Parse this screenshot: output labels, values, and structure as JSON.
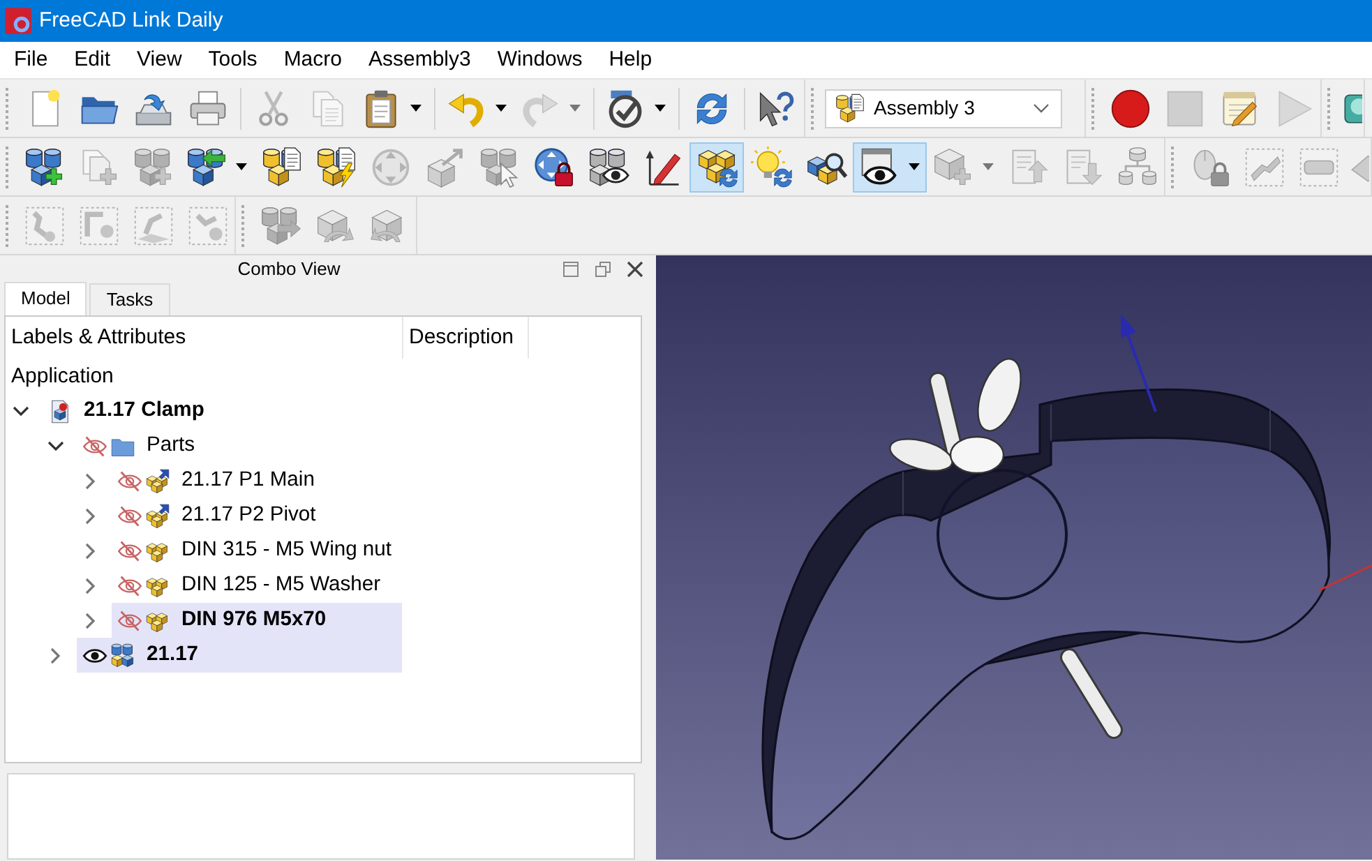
{
  "window": {
    "title": "FreeCAD Link Daily"
  },
  "menu": [
    "File",
    "Edit",
    "View",
    "Tools",
    "Macro",
    "Assembly3",
    "Windows",
    "Help"
  ],
  "toolbar_rows": [
    {
      "toolbars": [
        {
          "groups": [
            [
              {
                "kind": "new",
                "disabled": false,
                "pressed": false,
                "dropdown": false
              },
              {
                "kind": "open",
                "disabled": false,
                "pressed": false,
                "dropdown": false
              },
              {
                "kind": "save",
                "disabled": false,
                "pressed": false,
                "dropdown": false
              },
              {
                "kind": "print",
                "disabled": false,
                "pressed": false,
                "dropdown": false
              }
            ],
            [
              {
                "kind": "cut",
                "disabled": true,
                "pressed": false,
                "dropdown": false
              },
              {
                "kind": "copy",
                "disabled": true,
                "pressed": false,
                "dropdown": false
              },
              {
                "kind": "paste",
                "disabled": false,
                "pressed": false,
                "dropdown": true
              }
            ],
            [
              {
                "kind": "undo",
                "disabled": false,
                "pressed": false,
                "dropdown": true
              },
              {
                "kind": "redo",
                "disabled": true,
                "pressed": false,
                "dropdown": true
              }
            ],
            [
              {
                "kind": "validate",
                "disabled": false,
                "pressed": false,
                "dropdown": true
              }
            ],
            [
              {
                "kind": "refresh",
                "disabled": false,
                "pressed": false,
                "dropdown": false
              }
            ],
            [
              {
                "kind": "whatsthis",
                "disabled": false,
                "pressed": false,
                "dropdown": false
              }
            ]
          ]
        },
        {
          "groups": [
            [
              {
                "kind": "combo",
                "label": "Assembly 3"
              }
            ]
          ]
        },
        {
          "groups": [
            [
              {
                "kind": "record",
                "disabled": false,
                "pressed": false,
                "dropdown": false
              },
              {
                "kind": "stop",
                "disabled": true,
                "pressed": false,
                "dropdown": false
              },
              {
                "kind": "macro_edit",
                "disabled": false,
                "pressed": false,
                "dropdown": false
              },
              {
                "kind": "play",
                "disabled": true,
                "pressed": false,
                "dropdown": false
              }
            ]
          ]
        },
        {
          "groups": [
            [
              {
                "kind": "clipped",
                "disabled": false,
                "pressed": false,
                "dropdown": false
              }
            ]
          ]
        }
      ]
    },
    {
      "toolbars": [
        {
          "groups": [
            [
              {
                "kind": "asm_new",
                "disabled": false,
                "pressed": false,
                "dropdown": false
              },
              {
                "kind": "doc_plus",
                "disabled": true,
                "pressed": false,
                "dropdown": false
              },
              {
                "kind": "cyl_plus",
                "disabled": true,
                "pressed": false,
                "dropdown": false
              },
              {
                "kind": "cyl_import",
                "disabled": false,
                "pressed": false,
                "dropdown": true
              },
              {
                "kind": "cyl_doc",
                "disabled": false,
                "pressed": false,
                "dropdown": false
              },
              {
                "kind": "cyl_bolt",
                "disabled": false,
                "pressed": false,
                "dropdown": false
              },
              {
                "kind": "move",
                "disabled": true,
                "pressed": false,
                "dropdown": false
              },
              {
                "kind": "cube_out",
                "disabled": true,
                "pressed": false,
                "dropdown": false
              },
              {
                "kind": "cyl_cursor",
                "disabled": true,
                "pressed": false,
                "dropdown": false
              },
              {
                "kind": "lock_move",
                "disabled": false,
                "pressed": false,
                "dropdown": false
              },
              {
                "kind": "cyl_eye",
                "disabled": false,
                "pressed": false,
                "dropdown": false
              },
              {
                "kind": "axis_pencil",
                "disabled": false,
                "pressed": false,
                "dropdown": false
              },
              {
                "kind": "cube_sync",
                "disabled": false,
                "pressed": true,
                "dropdown": false
              },
              {
                "kind": "bulb",
                "disabled": false,
                "pressed": false,
                "dropdown": false
              },
              {
                "kind": "cube_search",
                "disabled": false,
                "pressed": false,
                "dropdown": false
              },
              {
                "kind": "eye_window",
                "disabled": false,
                "pressed": true,
                "dropdown": true
              },
              {
                "kind": "cube_plus",
                "disabled": true,
                "pressed": false,
                "dropdown": true
              },
              {
                "kind": "doc_up",
                "disabled": true,
                "pressed": false,
                "dropdown": false
              },
              {
                "kind": "doc_down",
                "disabled": true,
                "pressed": false,
                "dropdown": false
              },
              {
                "kind": "tree",
                "disabled": true,
                "pressed": false,
                "dropdown": false
              }
            ]
          ]
        },
        {
          "groups": [
            [
              {
                "kind": "mouse_lock",
                "disabled": true,
                "pressed": false,
                "dropdown": false
              },
              {
                "kind": "frame_part",
                "disabled": true,
                "pressed": false,
                "dropdown": false
              },
              {
                "kind": "frame_rect",
                "disabled": true,
                "pressed": false,
                "dropdown": false
              },
              {
                "kind": "clipped_part",
                "disabled": true,
                "pressed": false,
                "dropdown": false
              }
            ]
          ]
        }
      ]
    },
    {
      "toolbars": [
        {
          "groups": [
            [
              {
                "kind": "arm",
                "disabled": true,
                "pressed": false,
                "dropdown": false
              },
              {
                "kind": "arm_corner",
                "disabled": true,
                "pressed": false,
                "dropdown": false
              },
              {
                "kind": "arm_plane",
                "disabled": true,
                "pressed": false,
                "dropdown": false
              },
              {
                "kind": "arm_swap",
                "disabled": true,
                "pressed": false,
                "dropdown": false
              }
            ]
          ]
        },
        {
          "groups": [
            [
              {
                "kind": "cyl_arrow",
                "disabled": true,
                "pressed": false,
                "dropdown": false
              },
              {
                "kind": "cube_turn",
                "disabled": true,
                "pressed": false,
                "dropdown": false
              },
              {
                "kind": "cube_turn_back",
                "disabled": true,
                "pressed": false,
                "dropdown": false
              }
            ]
          ]
        }
      ]
    }
  ],
  "combo_view": {
    "title": "Combo View",
    "tabs": [
      {
        "label": "Model",
        "selected": true
      },
      {
        "label": "Tasks",
        "selected": false
      }
    ],
    "columns": [
      "Labels & Attributes",
      "Description"
    ],
    "root": "Application",
    "tree": [
      {
        "label": "21.17 Clamp",
        "kind": "document",
        "active": true,
        "selected": false,
        "expanded": true,
        "children": [
          {
            "label": "Parts",
            "kind": "folder",
            "visible": false,
            "active": false,
            "selected": false,
            "expanded": true,
            "children": [
              {
                "label": "21.17 P1 Main",
                "kind": "link",
                "visible": false,
                "active": false,
                "selected": false,
                "expanded": false
              },
              {
                "label": "21.17 P2 Pivot",
                "kind": "link",
                "visible": false,
                "active": false,
                "selected": false,
                "expanded": false
              },
              {
                "label": "DIN 315 - M5 Wing nut",
                "kind": "part",
                "visible": false,
                "active": false,
                "selected": false,
                "expanded": false
              },
              {
                "label": "DIN 125 - M5 Washer",
                "kind": "part",
                "visible": false,
                "active": false,
                "selected": false,
                "expanded": false
              },
              {
                "label": "DIN 976 M5x70",
                "kind": "part",
                "visible": false,
                "active": true,
                "selected": true,
                "expanded": false
              }
            ]
          },
          {
            "label": "21.17",
            "kind": "assembly",
            "visible": true,
            "active": true,
            "selected": true,
            "expanded": false
          }
        ]
      }
    ]
  }
}
